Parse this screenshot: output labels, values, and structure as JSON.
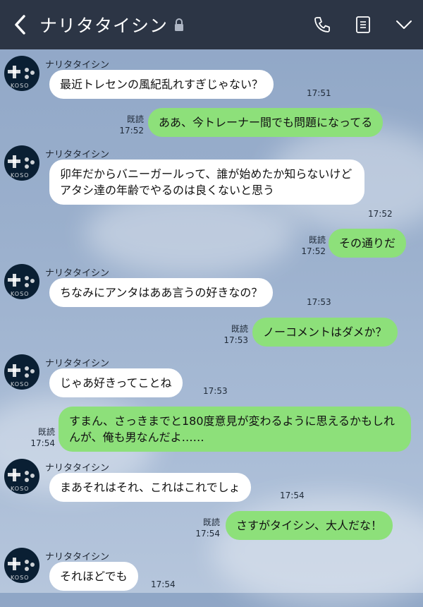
{
  "header": {
    "title": "ナリタタイシン",
    "icons": [
      "back-chevron-icon",
      "lock-icon",
      "phone-icon",
      "notes-icon",
      "chevron-down-icon"
    ]
  },
  "contact_name": "ナリタタイシン",
  "avatar_watermark": "KOSO",
  "read_label": "既読",
  "messages": [
    {
      "from": "them",
      "text": "最近トレセンの風紀乱れすぎじゃない？",
      "time": "17:51"
    },
    {
      "from": "me",
      "text": "ああ、今トレーナー間でも問題になってる",
      "time": "17:52",
      "read": "既読"
    },
    {
      "from": "them",
      "text": "卯年だからバニーガールって、誰が始めたか知らないけどアタシ達の年齢でやるのは良くないと思う",
      "time": "17:52"
    },
    {
      "from": "me",
      "text": "その通りだ",
      "time": "17:52",
      "read": "既読"
    },
    {
      "from": "them",
      "text": "ちなみにアンタはああ言うの好きなの？",
      "time": "17:53"
    },
    {
      "from": "me",
      "text": "ノーコメントはダメか？",
      "time": "17:53",
      "read": "既読"
    },
    {
      "from": "them",
      "text": "じゃあ好きってことね",
      "time": "17:53"
    },
    {
      "from": "me",
      "text": "すまん、さっきまでと180度意見が変わるように思えるかもしれんが、俺も男なんだよ……",
      "time": "17:54",
      "read": "既読"
    },
    {
      "from": "them",
      "text": "まあそれはそれ、これはこれでしょ",
      "time": "17:54"
    },
    {
      "from": "me",
      "text": "さすがタイシン、大人だな！",
      "time": "17:54",
      "read": "既読"
    },
    {
      "from": "them",
      "text": "それほどでも",
      "time": "17:54"
    }
  ],
  "colors": {
    "header": "#2c3545",
    "out_bubble": "#8de07a",
    "in_bubble": "#ffffff"
  }
}
